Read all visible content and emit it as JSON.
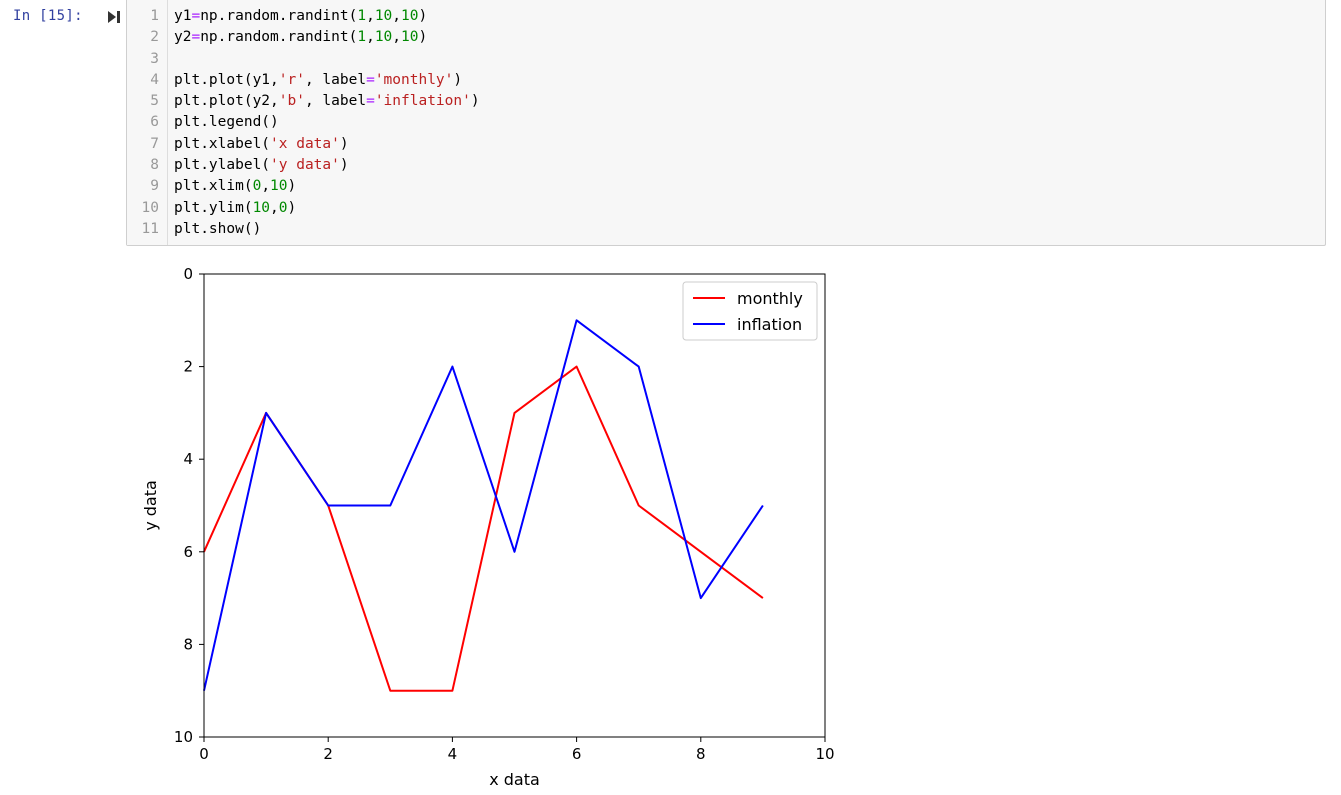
{
  "cell": {
    "prompt": "In [15]:",
    "code_lines": [
      {
        "num": "1",
        "tokens": [
          {
            "t": "y1",
            "c": "plain"
          },
          {
            "t": "=",
            "c": "op"
          },
          {
            "t": "np.random.randint(",
            "c": "plain"
          },
          {
            "t": "1",
            "c": "num"
          },
          {
            "t": ",",
            "c": "plain"
          },
          {
            "t": "10",
            "c": "num"
          },
          {
            "t": ",",
            "c": "plain"
          },
          {
            "t": "10",
            "c": "num"
          },
          {
            "t": ")",
            "c": "plain"
          }
        ]
      },
      {
        "num": "2",
        "tokens": [
          {
            "t": "y2",
            "c": "plain"
          },
          {
            "t": "=",
            "c": "op"
          },
          {
            "t": "np.random.randint(",
            "c": "plain"
          },
          {
            "t": "1",
            "c": "num"
          },
          {
            "t": ",",
            "c": "plain"
          },
          {
            "t": "10",
            "c": "num"
          },
          {
            "t": ",",
            "c": "plain"
          },
          {
            "t": "10",
            "c": "num"
          },
          {
            "t": ")",
            "c": "plain"
          }
        ]
      },
      {
        "num": "3",
        "tokens": []
      },
      {
        "num": "4",
        "tokens": [
          {
            "t": "plt.plot(y1,",
            "c": "plain"
          },
          {
            "t": "'r'",
            "c": "str"
          },
          {
            "t": ", label",
            "c": "plain"
          },
          {
            "t": "=",
            "c": "op"
          },
          {
            "t": "'monthly'",
            "c": "str"
          },
          {
            "t": ")",
            "c": "plain"
          }
        ]
      },
      {
        "num": "5",
        "tokens": [
          {
            "t": "plt.plot(y2,",
            "c": "plain"
          },
          {
            "t": "'b'",
            "c": "str"
          },
          {
            "t": ", label",
            "c": "plain"
          },
          {
            "t": "=",
            "c": "op"
          },
          {
            "t": "'inflation'",
            "c": "str"
          },
          {
            "t": ")",
            "c": "plain"
          }
        ]
      },
      {
        "num": "6",
        "tokens": [
          {
            "t": "plt.legend()",
            "c": "plain"
          }
        ]
      },
      {
        "num": "7",
        "tokens": [
          {
            "t": "plt.xlabel(",
            "c": "plain"
          },
          {
            "t": "'x data'",
            "c": "str"
          },
          {
            "t": ")",
            "c": "plain"
          }
        ]
      },
      {
        "num": "8",
        "tokens": [
          {
            "t": "plt.ylabel(",
            "c": "plain"
          },
          {
            "t": "'y data'",
            "c": "str"
          },
          {
            "t": ")",
            "c": "plain"
          }
        ]
      },
      {
        "num": "9",
        "tokens": [
          {
            "t": "plt.xlim(",
            "c": "plain"
          },
          {
            "t": "0",
            "c": "num"
          },
          {
            "t": ",",
            "c": "plain"
          },
          {
            "t": "10",
            "c": "num"
          },
          {
            "t": ")",
            "c": "plain"
          }
        ]
      },
      {
        "num": "10",
        "tokens": [
          {
            "t": "plt.ylim(",
            "c": "plain"
          },
          {
            "t": "10",
            "c": "num"
          },
          {
            "t": ",",
            "c": "plain"
          },
          {
            "t": "0",
            "c": "num"
          },
          {
            "t": ")",
            "c": "plain"
          }
        ]
      },
      {
        "num": "11",
        "tokens": [
          {
            "t": "plt.show()",
            "c": "plain"
          }
        ]
      }
    ]
  },
  "chart_data": {
    "type": "line",
    "xlabel": "x data",
    "ylabel": "y data",
    "xlim": [
      0,
      10
    ],
    "ylim": [
      10,
      0
    ],
    "y_inverted": true,
    "x_ticks": [
      0,
      2,
      4,
      6,
      8,
      10
    ],
    "y_ticks": [
      0,
      2,
      4,
      6,
      8,
      10
    ],
    "grid": false,
    "legend_position": "top-right",
    "series": [
      {
        "name": "monthly",
        "color": "#ff0000",
        "x": [
          0,
          1,
          2,
          3,
          4,
          5,
          6,
          7,
          8,
          9
        ],
        "y": [
          6,
          3,
          5,
          9,
          9,
          3,
          2,
          5,
          6,
          7
        ]
      },
      {
        "name": "inflation",
        "color": "#0000ff",
        "x": [
          0,
          1,
          2,
          3,
          4,
          5,
          6,
          7,
          8,
          9
        ],
        "y": [
          9,
          3,
          5,
          5,
          2,
          6,
          1,
          2,
          7,
          5
        ]
      }
    ]
  }
}
